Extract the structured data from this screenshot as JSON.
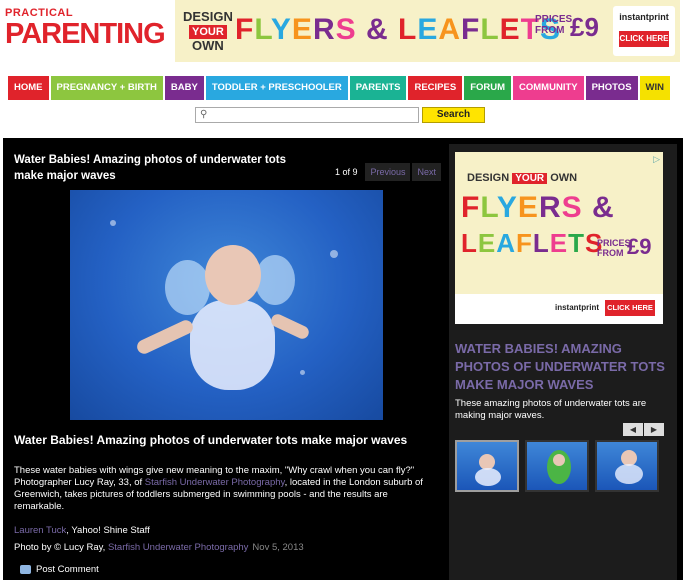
{
  "logo": {
    "top": "PRACTICAL",
    "main": "PARENTING"
  },
  "top_ad": {
    "design": "DESIGN",
    "your": "YOUR",
    "own": "OWN",
    "headline": "FLYERS & LEAFLETS",
    "prices_line1": "PRICES",
    "prices_line2": "FROM",
    "price": "£9",
    "brand": "instantprint",
    "cta": "CLICK HERE"
  },
  "nav": [
    {
      "label": "HOME",
      "color": "#e0232b"
    },
    {
      "label": "PREGNANCY + BIRTH",
      "color": "#8dc63f"
    },
    {
      "label": "BABY",
      "color": "#7a2c8f"
    },
    {
      "label": "TODDLER + PRESCHOOLER",
      "color": "#29a8e0"
    },
    {
      "label": "PARENTS",
      "color": "#1ab394"
    },
    {
      "label": "RECIPES",
      "color": "#e0232b"
    },
    {
      "label": "FORUM",
      "color": "#2aa84a"
    },
    {
      "label": "COMMUNITY",
      "color": "#ee3d8f"
    },
    {
      "label": "PHOTOS",
      "color": "#7a2c8f"
    },
    {
      "label": "WIN",
      "color": "#f5e100"
    }
  ],
  "search": {
    "placeholder": "",
    "button": "Search"
  },
  "gallery": {
    "title": "Water Babies! Amazing photos of underwater tots make major waves",
    "count": "1 of 9",
    "prev": "Previous",
    "next": "Next",
    "subhead": "Water Babies! Amazing photos of underwater tots make major waves",
    "desc_part1": "These water babies with wings give new meaning to the maxim, \"Why crawl when you can fly?\" Photographer Lucy Ray, 33, of ",
    "desc_link": "Starfish Underwater Photography",
    "desc_part2": ", located in the London suburb of Greenwich, takes pictures of toddlers submerged in swimming pools - and the results are remarkable.",
    "author": "Lauren Tuck",
    "author_suffix": ", Yahoo! Shine Staff",
    "credit_prefix": "Photo by © Lucy Ray, ",
    "credit_link": "Starfish Underwater Photography",
    "date": "Nov 5, 2013",
    "post_comment": "Post Comment"
  },
  "side_ad": {
    "adx": "▷",
    "design": "DESIGN",
    "your": "YOUR",
    "own": "OWN",
    "line1": "FLYERS &",
    "line2": "LEAFLETS",
    "prices_line1": "PRICES",
    "prices_line2": "FROM",
    "price": "£9",
    "brand": "instantprint",
    "cta": "CLICK HERE"
  },
  "sidebar": {
    "title": "WATER BABIES! AMAZING PHOTOS OF UNDERWATER TOTS MAKE MAJOR WAVES",
    "desc": "These amazing photos of underwater tots are making major waves.",
    "prev_arrow": "◀",
    "next_arrow": "▶"
  }
}
